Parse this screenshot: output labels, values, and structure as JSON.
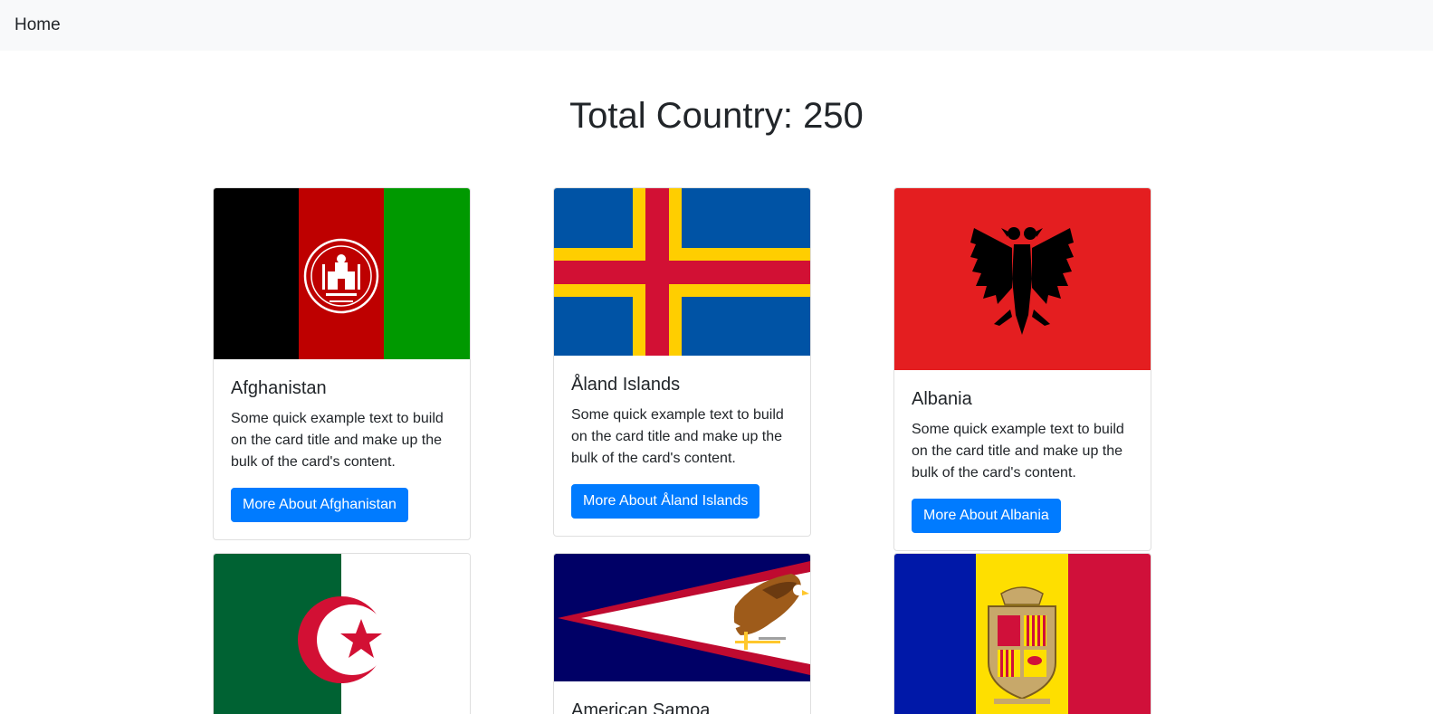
{
  "navbar": {
    "home_label": "Home"
  },
  "header": {
    "title": "Total Country: 250"
  },
  "cards": [
    {
      "name": "Afghanistan",
      "text": "Some quick example text to build on the card title and make up the bulk of the card's content.",
      "button": "More About Afghanistan",
      "flag": "afghanistan-flag"
    },
    {
      "name": "Åland Islands",
      "text": "Some quick example text to build on the card title and make up the bulk of the card's content.",
      "button": "More About Åland Islands",
      "flag": "aland-islands-flag"
    },
    {
      "name": "Albania",
      "text": "Some quick example text to build on the card title and make up the bulk of the card's content.",
      "button": "More About Albania",
      "flag": "albania-flag"
    },
    {
      "flag": "algeria-flag"
    },
    {
      "name": "American Samoa",
      "flag": "american-samoa-flag"
    },
    {
      "flag": "andorra-flag"
    }
  ],
  "colors": {
    "primary": "#007bff",
    "navbar_bg": "#f8f9fa",
    "text": "#212529"
  }
}
